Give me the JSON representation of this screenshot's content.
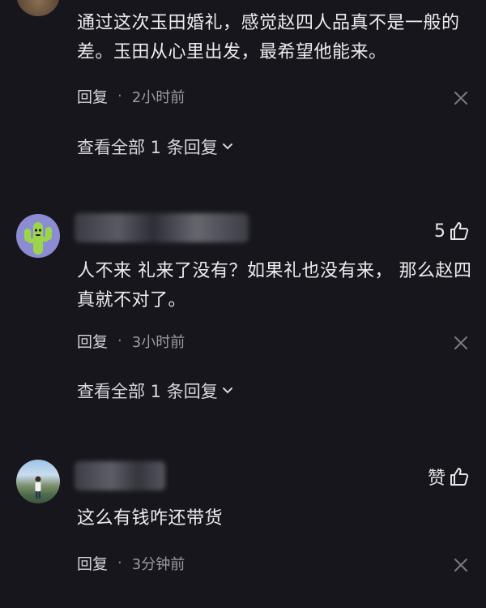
{
  "comments": [
    {
      "text": "通过这次玉田婚礼，感觉赵四人品真不是一般的差。玉田从心里出发，最希望他能来。",
      "reply_label": "回复",
      "time": "2小时前",
      "view_replies": "查看全部 1 条回复"
    },
    {
      "likes": "5",
      "text": "人不来 礼来了没有？如果礼也没有来， 那么赵四真就不对了。",
      "reply_label": "回复",
      "time": "3小时前",
      "view_replies": "查看全部 1 条回复"
    },
    {
      "like_label": "赞",
      "text": "这么有钱咋还带货",
      "reply_label": "回复",
      "time": "3分钟前"
    }
  ],
  "colors": {
    "background": "#16161c",
    "text_primary": "#ececf0",
    "text_secondary": "#9a9aa2",
    "avatar_cactus": "#9bd64a",
    "avatar_cactus_bg": "#8c8cd2"
  },
  "icons": [
    "thumb-up-icon",
    "close-icon",
    "chevron-down-icon"
  ]
}
